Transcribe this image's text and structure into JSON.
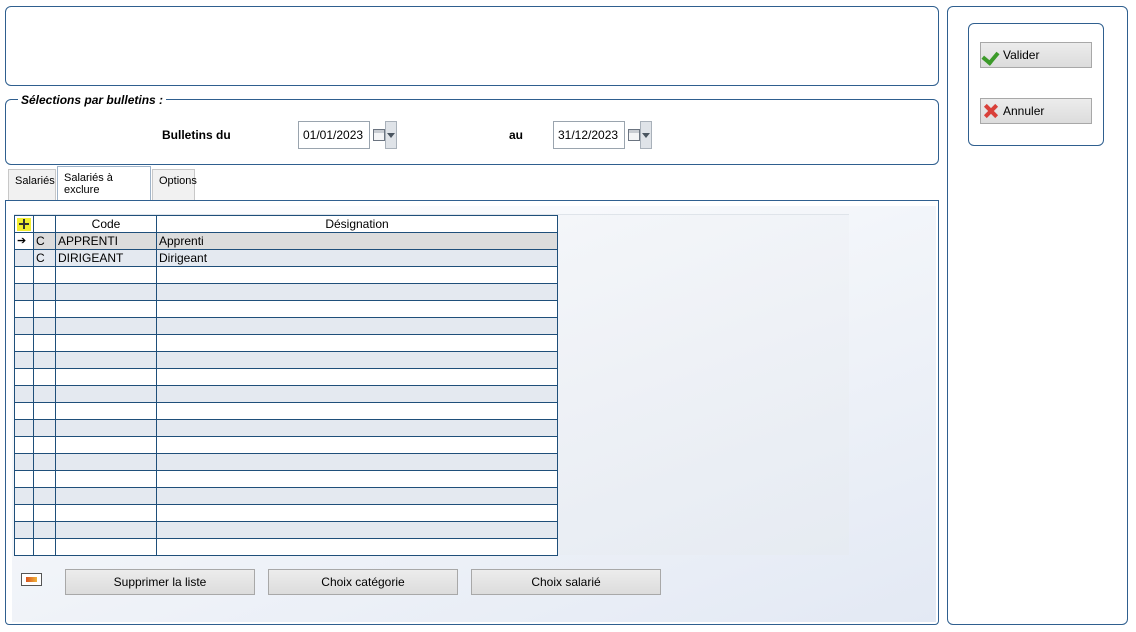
{
  "selection": {
    "legend": "Sélections par bulletins :",
    "from_label": "Bulletins du",
    "from_value": "01/01/2023",
    "to_label": "au",
    "to_value": "31/12/2023"
  },
  "tabs": [
    {
      "label": "Salariés"
    },
    {
      "label": "Salariés à exclure"
    },
    {
      "label": "Options"
    }
  ],
  "grid": {
    "headers": {
      "code": "Code",
      "designation": "Désignation"
    },
    "rows": [
      {
        "type": "C",
        "code": "APPRENTI",
        "designation": "Apprenti"
      },
      {
        "type": "C",
        "code": "DIRIGEANT",
        "designation": "Dirigeant"
      }
    ]
  },
  "buttons": {
    "clear_list": "Supprimer la liste",
    "choose_category": "Choix catégorie",
    "choose_employee": "Choix salarié"
  },
  "actions": {
    "validate": "Valider",
    "cancel": "Annuler"
  },
  "colors": {
    "border": "#2f5f8f",
    "grid_line": "#1f4f7a",
    "alt_row": "#e4e9f0",
    "add_icon": "#f2ee2e"
  },
  "icons": [
    "calendar-icon",
    "dropdown-arrow-icon",
    "add-row-icon",
    "row-pointer-icon",
    "legend-icon",
    "check-icon",
    "cross-icon"
  ]
}
